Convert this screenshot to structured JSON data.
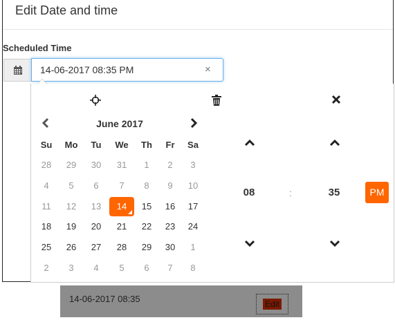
{
  "modal": {
    "title": "Edit Date and time"
  },
  "field": {
    "label": "Scheduled Time",
    "value": "14-06-2017 08:35 PM",
    "clear_glyph": "×"
  },
  "picker": {
    "tools": {
      "today_icon": "crosshair-icon",
      "clear_icon": "trash-icon",
      "close_icon": "close-icon"
    },
    "month_label": "June 2017",
    "weekdays": [
      "Su",
      "Mo",
      "Tu",
      "We",
      "Th",
      "Fr",
      "Sa"
    ],
    "weeks": [
      [
        "28",
        "29",
        "30",
        "31",
        "1",
        "2",
        "3"
      ],
      [
        "4",
        "5",
        "6",
        "7",
        "8",
        "9",
        "10"
      ],
      [
        "11",
        "12",
        "13",
        "14",
        "15",
        "16",
        "17"
      ],
      [
        "18",
        "19",
        "20",
        "21",
        "22",
        "23",
        "24"
      ],
      [
        "25",
        "26",
        "27",
        "28",
        "29",
        "30",
        "1"
      ],
      [
        "2",
        "3",
        "4",
        "5",
        "6",
        "7",
        "8"
      ]
    ],
    "muted_days": [
      [
        0,
        0
      ],
      [
        0,
        1
      ],
      [
        0,
        2
      ],
      [
        0,
        3
      ],
      [
        0,
        4
      ],
      [
        0,
        5
      ],
      [
        0,
        6
      ],
      [
        1,
        0
      ],
      [
        1,
        1
      ],
      [
        1,
        2
      ],
      [
        1,
        3
      ],
      [
        1,
        4
      ],
      [
        1,
        5
      ],
      [
        1,
        6
      ],
      [
        2,
        0
      ],
      [
        2,
        1
      ],
      [
        2,
        2
      ],
      [
        4,
        6
      ],
      [
        5,
        0
      ],
      [
        5,
        1
      ],
      [
        5,
        2
      ],
      [
        5,
        3
      ],
      [
        5,
        4
      ],
      [
        5,
        5
      ],
      [
        5,
        6
      ]
    ],
    "selected_day": [
      2,
      3
    ],
    "time": {
      "hour": "08",
      "separator": ":",
      "minute": "35",
      "period": "PM"
    }
  },
  "row": {
    "text": "14-06-2017 08:35",
    "edit_label": "Edit"
  },
  "colors": {
    "accent": "#ff6600",
    "focus_border": "#66afe9",
    "muted_text": "#999999"
  }
}
